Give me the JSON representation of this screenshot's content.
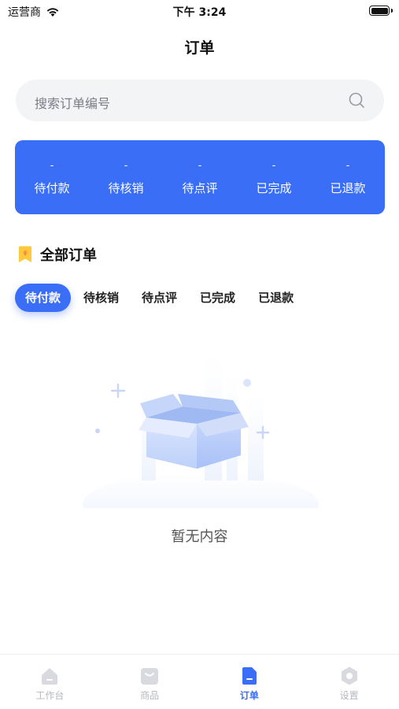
{
  "status_bar": {
    "carrier": "运营商",
    "time": "下午 3:24"
  },
  "header": {
    "title": "订单"
  },
  "search": {
    "placeholder": "搜索订单编号"
  },
  "stats": [
    {
      "value": "-",
      "label": "待付款"
    },
    {
      "value": "-",
      "label": "待核销"
    },
    {
      "value": "-",
      "label": "待点评"
    },
    {
      "value": "-",
      "label": "已完成"
    },
    {
      "value": "-",
      "label": "已退款"
    }
  ],
  "section": {
    "title": "全部订单"
  },
  "filter_tabs": [
    {
      "label": "待付款",
      "active": true
    },
    {
      "label": "待核销",
      "active": false
    },
    {
      "label": "待点评",
      "active": false
    },
    {
      "label": "已完成",
      "active": false
    },
    {
      "label": "已退款",
      "active": false
    }
  ],
  "empty_state": {
    "message": "暂无内容"
  },
  "tab_bar": [
    {
      "label": "工作台",
      "icon": "home-icon",
      "active": false
    },
    {
      "label": "商品",
      "icon": "bag-icon",
      "active": false
    },
    {
      "label": "订单",
      "icon": "order-icon",
      "active": true
    },
    {
      "label": "设置",
      "icon": "settings-icon",
      "active": false
    }
  ],
  "colors": {
    "accent": "#3b6ef6",
    "inactive_tab": "#b5b8bf"
  }
}
